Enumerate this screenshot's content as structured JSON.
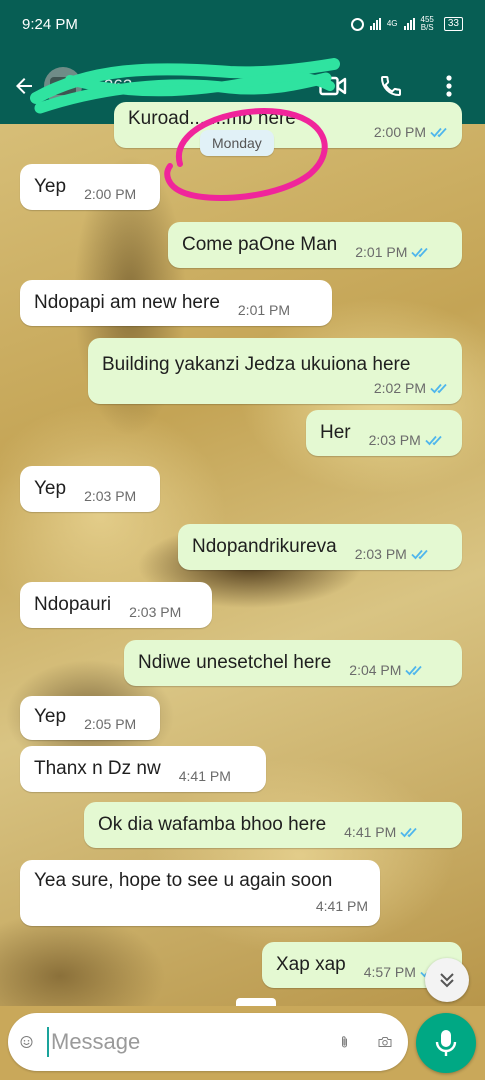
{
  "status_bar": {
    "time": "9:24 PM",
    "network_label": "4G",
    "speed_value": "455",
    "speed_unit": "B/S",
    "battery": "33"
  },
  "header": {
    "contact_name": "+263 ...",
    "icons": [
      "back-arrow-icon",
      "video-call-icon",
      "phone-icon",
      "more-vert-icon"
    ]
  },
  "chat": {
    "date_chip": "Monday",
    "messages": [
      {
        "dir": "out",
        "text": "Kuroad... ...mb here",
        "time": "2:00 PM",
        "ticks": "read"
      },
      {
        "dir": "in",
        "text": "Yep",
        "time": "2:00 PM"
      },
      {
        "dir": "out",
        "text": "Come paOne Man",
        "time": "2:01 PM",
        "ticks": "read"
      },
      {
        "dir": "in",
        "text": "Ndopapi am new here",
        "time": "2:01 PM"
      },
      {
        "dir": "out",
        "text": "Building yakanzi Jedza ukuiona here",
        "time": "2:02 PM",
        "ticks": "read"
      },
      {
        "dir": "out",
        "text": "Her",
        "time": "2:03 PM",
        "ticks": "read"
      },
      {
        "dir": "in",
        "text": "Yep",
        "time": "2:03 PM"
      },
      {
        "dir": "out",
        "text": "Ndopandrikureva",
        "time": "2:03 PM",
        "ticks": "read"
      },
      {
        "dir": "in",
        "text": "Ndopauri",
        "time": "2:03 PM"
      },
      {
        "dir": "out",
        "text": "Ndiwe unesetchel here",
        "time": "2:04 PM",
        "ticks": "read"
      },
      {
        "dir": "in",
        "text": "Yep",
        "time": "2:05 PM"
      },
      {
        "dir": "in",
        "text": "Thanx n Dz nw",
        "time": "4:41 PM"
      },
      {
        "dir": "out",
        "text": "Ok dia wafamba bhoo here",
        "time": "4:41 PM",
        "ticks": "read"
      },
      {
        "dir": "in",
        "text": "Yea sure, hope to see u again soon",
        "time": "4:41 PM"
      },
      {
        "dir": "out",
        "text": "Xap xap",
        "time": "4:57 PM",
        "ticks": "read"
      }
    ]
  },
  "composer": {
    "placeholder": "Message",
    "value": ""
  },
  "colors": {
    "header": "#075e54",
    "outgoing_bubble": "#e4f9d2",
    "incoming_bubble": "#ffffff",
    "read_ticks": "#4fb6ec",
    "mic_button": "#00a884",
    "annotation_pink": "#f0259b",
    "scribble_green": "#2fe3a0"
  }
}
